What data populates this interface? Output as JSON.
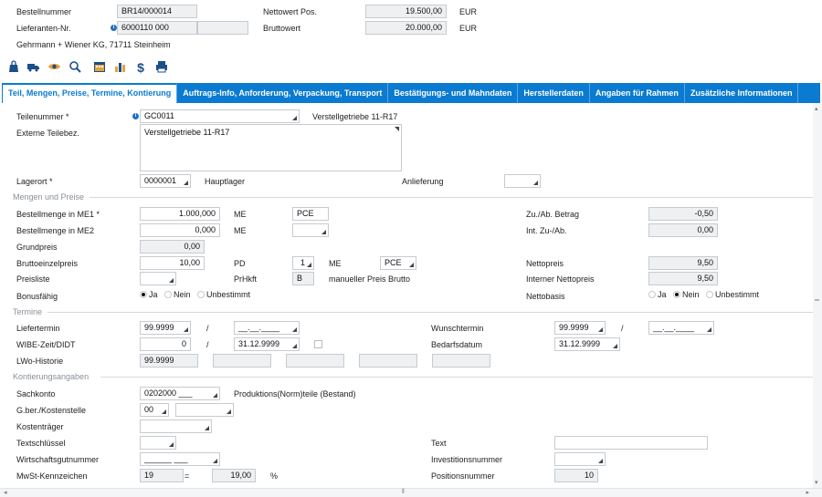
{
  "header": {
    "bestellnummer_label": "Bestellnummer",
    "bestellnummer_value": "BR14/000014",
    "lieferanten_label": "Lieferanten-Nr.",
    "lieferanten_value": "6000110 000",
    "supplier_address": "Gehrmann + Wiener KG, 71711 Steinheim",
    "nettowert_label": "Nettowert Pos.",
    "nettowert_value": "19.500,00",
    "nettowert_currency": "EUR",
    "bruttowert_label": "Bruttowert",
    "bruttowert_value": "20.000,00",
    "bruttowert_currency": "EUR"
  },
  "toolbar": {
    "icons": [
      "bag-icon",
      "truck-icon",
      "eye-icon",
      "magnifier-icon",
      "calendar-icon",
      "chart-icon",
      "dollar-icon",
      "printer-icon"
    ]
  },
  "tabs": [
    "Teil, Mengen, Preise, Termine, Kontierung",
    "Auftrags-Info, Anforderung, Verpackung, Transport",
    "Bestätigungs- und Mahndaten",
    "Herstellerdaten",
    "Angaben für Rahmen",
    "Zusätzliche Informationen"
  ],
  "teil": {
    "teilenummer_label": "Teilenummer *",
    "teilenummer_value": "GC0011",
    "teilenummer_desc": "Verstellgetriebe 11-R17",
    "externe_label": "Externe Teilebez.",
    "externe_value": "Verstellgetriebe 11-R17",
    "lagerort_label": "Lagerort *",
    "lagerort_value": "0000001",
    "lagerort_desc": "Hauptlager",
    "anlieferung_label": "Anlieferung"
  },
  "mengen": {
    "section": "Mengen und Preise",
    "me1_label": "Bestellmenge in ME1 *",
    "me1_value": "1.000,000",
    "me_label": "ME",
    "me1_unit": "PCE",
    "me2_label": "Bestellmenge in ME2",
    "me2_value": "0,000",
    "grundpreis_label": "Grundpreis",
    "grundpreis_value": "0,00",
    "brutto_label": "Bruttoeinzelpreis",
    "brutto_value": "10,00",
    "pd_label": "PD",
    "pd_value": "1",
    "me3_unit": "PCE",
    "preisliste_label": "Preisliste",
    "prhkft_label": "PrHkft",
    "prhkft_value": "B",
    "prhkft_desc": "manueller Preis Brutto",
    "bonus_label": "Bonusfähig",
    "opt_ja": "Ja",
    "opt_nein": "Nein",
    "opt_unbestimmt": "Unbestimmt",
    "zuab_label": "Zu./Ab. Betrag",
    "zuab_value": "-0,50",
    "intzuab_label": "Int. Zu-/Ab.",
    "intzuab_value": "0,00",
    "netto_label": "Nettopreis",
    "netto_value": "9,50",
    "intnetto_label": "Interner Nettopreis",
    "intnetto_value": "9,50",
    "nettobasis_label": "Nettobasis"
  },
  "termine": {
    "section": "Termine",
    "liefer_label": "Liefertermin",
    "liefer_value": "99.9999",
    "slash": "/",
    "date_placeholder": "__.__.____",
    "wibe_label": "WIBE-Zeit/DIDT",
    "wibe_value": "0",
    "wibe_date": "31.12.9999",
    "lwo_label": "LWo-Historie",
    "lwo_value": "99.9999",
    "wunsch_label": "Wunschtermin",
    "wunsch_value": "99.9999",
    "bedarf_label": "Bedarfsdatum",
    "bedarf_value": "31.12.9999"
  },
  "kontierung": {
    "section": "Kontierungsangaben",
    "sachkonto_label": "Sachkonto",
    "sachkonto_value": "0202000 ___",
    "sachkonto_desc": "Produktions(Norm)teile (Bestand)",
    "gber_label": "G.ber./Kostenstelle",
    "gber_value": "00",
    "kostentraeger_label": "Kostenträger",
    "textschluessel_label": "Textschlüssel",
    "wirtschaft_label": "Wirtschaftsgutnummer",
    "wirtschaft_value": "______ ___",
    "mwst_label": "MwSt-Kennzeichen",
    "mwst_value": "19",
    "equals": "=",
    "mwst_rate": "19,00",
    "percent": "%",
    "text_label": "Text",
    "invest_label": "Investitionsnummer",
    "pos_label": "Positionsnummer",
    "pos_value": "10"
  }
}
